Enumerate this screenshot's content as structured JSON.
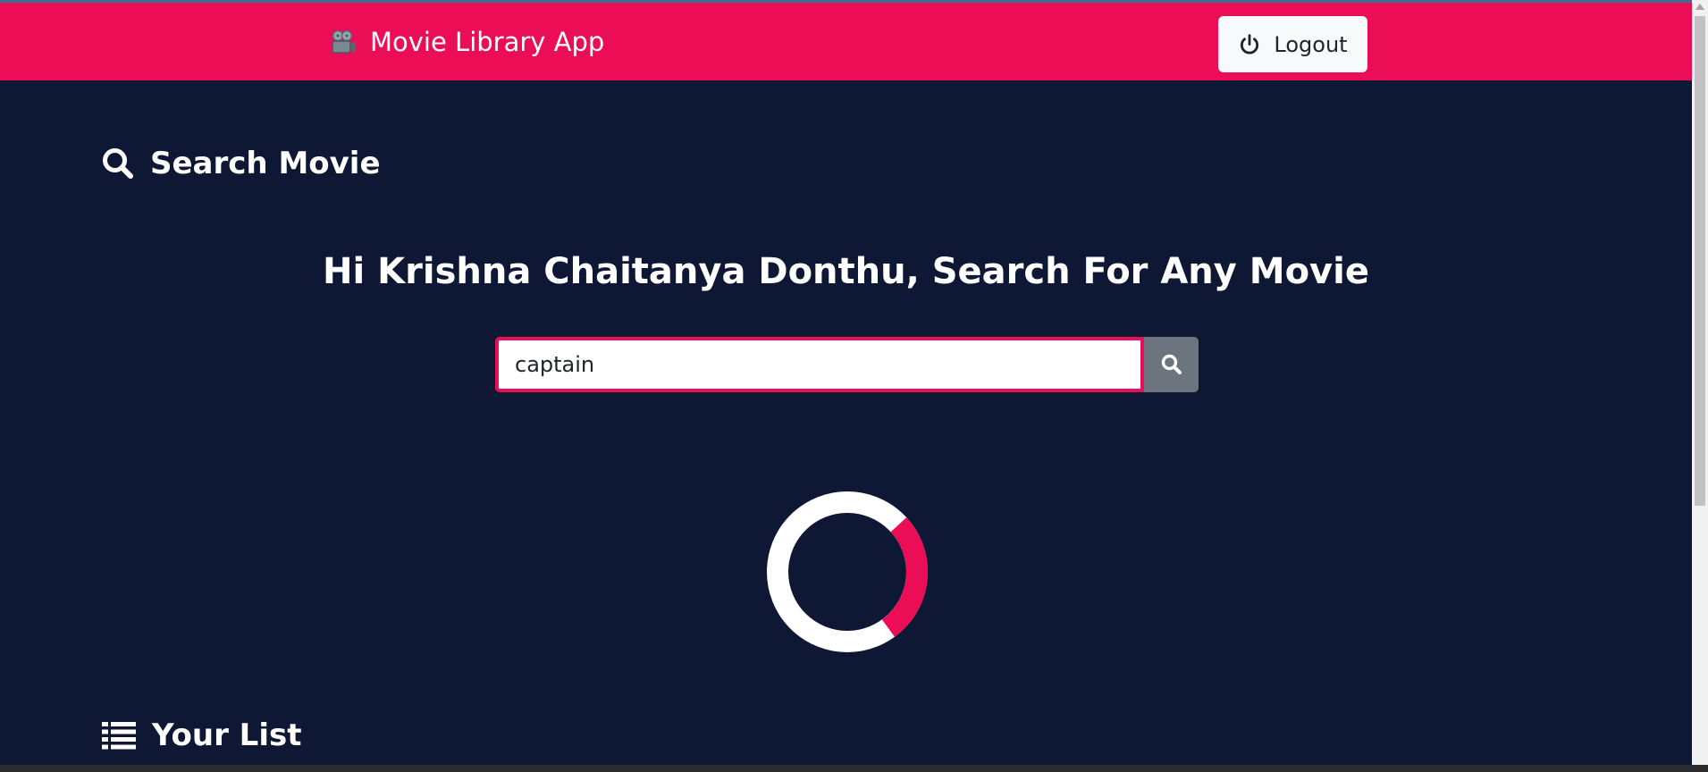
{
  "navbar": {
    "brand_label": "Movie Library App",
    "brand_icon": "movie-camera-icon",
    "logout_label": "Logout",
    "logout_icon": "power-icon"
  },
  "search_section": {
    "heading": "Search Movie",
    "heading_icon": "search-icon"
  },
  "greeting": "Hi Krishna Chaitanya Donthu, Search For Any Movie",
  "search": {
    "value": "captain",
    "button_icon": "search-icon"
  },
  "loading": {
    "icon": "loading-spinner"
  },
  "list_section": {
    "heading": "Your List",
    "heading_icon": "list-icon"
  },
  "colors": {
    "accent": "#eb0e56",
    "background": "#0e1834",
    "button_gray": "#6c757d",
    "light_button": "#f8f9fa"
  }
}
